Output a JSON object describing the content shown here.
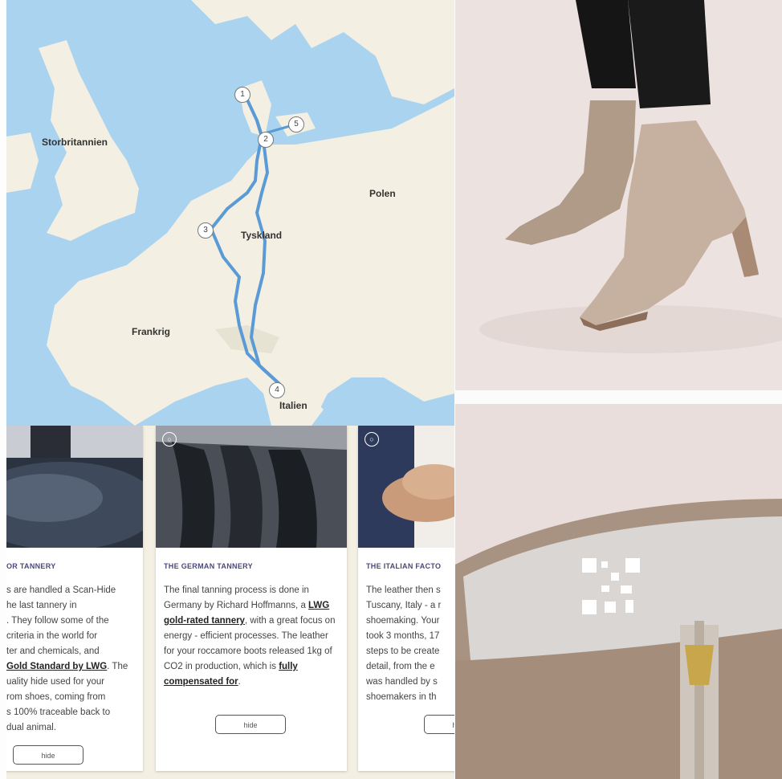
{
  "colors": {
    "sea": "#a9d3ef",
    "land": "#f3efe3",
    "route": "#5b9bd5",
    "card_title": "#4a4a7a"
  },
  "map": {
    "countries": {
      "uk": "Storbritannien",
      "poland": "Polen",
      "germany": "Tyskland",
      "france": "Frankrig",
      "italy": "Italien"
    },
    "pins": [
      "1",
      "2",
      "3",
      "4",
      "5"
    ]
  },
  "cards": [
    {
      "title": "OR TANNERY",
      "lines": [
        "s are handled a Scan-Hide",
        "he last tannery in",
        ". They follow some of the",
        "criteria in the world for",
        "ter and chemicals, and"
      ],
      "link": "Gold Standard by LWG",
      "after_link": ". The",
      "lines2": [
        "uality hide used for your",
        "rom shoes, coming from",
        "s 100% traceable back to",
        "dual animal."
      ],
      "hide": "hide"
    },
    {
      "title": "THE GERMAN TANNERY",
      "text_a": "The final tanning process is done in Germany by Richard Hoffmanns, a ",
      "link_a": "LWG gold-rated tannery",
      "text_b": ", with a great focus on energy - efficient processes. The leather for your roccamore boots released 1kg of CO2 in production, which is ",
      "link_b": "fully compensated for",
      "text_c": ".",
      "hide": "hide"
    },
    {
      "title": "THE ITALIAN FACTO",
      "lines": [
        "The leather then s",
        "Tuscany, Italy - a r",
        "shoemaking. Your",
        "took 3 months, 17",
        "steps to be create",
        "detail, from the e",
        "was handled by s",
        "shoemakers in th"
      ],
      "hide": "hide"
    }
  ]
}
